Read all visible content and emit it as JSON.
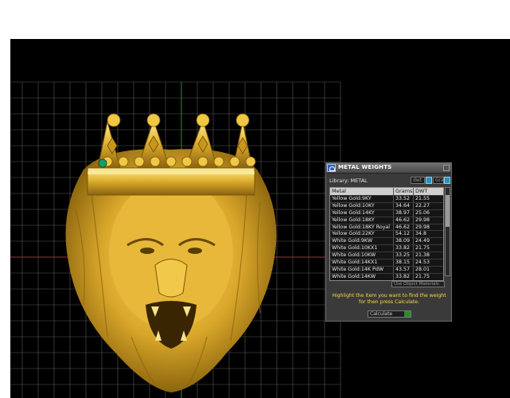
{
  "panel": {
    "title": "METAL WEIGHTS",
    "library_label": "Library: METAL",
    "selectors": [
      "dwt",
      "Gra"
    ],
    "columns": [
      "Metal",
      "Grams",
      "DWT"
    ],
    "rows": [
      {
        "metal": "Yellow Gold:9KY",
        "grams": "33.52",
        "dwt": "21.55"
      },
      {
        "metal": "Yellow Gold:10KY",
        "grams": "34.64",
        "dwt": "22.27"
      },
      {
        "metal": "Yellow Gold:14KY",
        "grams": "38.97",
        "dwt": "25.06"
      },
      {
        "metal": "Yellow Gold:18KY",
        "grams": "46.62",
        "dwt": "29.98"
      },
      {
        "metal": "Yellow Gold:18KY Royal",
        "grams": "46.62",
        "dwt": "29.98"
      },
      {
        "metal": "Yellow Gold:22KY",
        "grams": "54.12",
        "dwt": "34.8"
      },
      {
        "metal": "White Gold:9KW",
        "grams": "38.09",
        "dwt": "24.49"
      },
      {
        "metal": "White Gold:10KX1",
        "grams": "33.82",
        "dwt": "21.75"
      },
      {
        "metal": "White Gold:10KW",
        "grams": "33.25",
        "dwt": "21.38"
      },
      {
        "metal": "White Gold:14KX1",
        "grams": "38.15",
        "dwt": "24.53"
      },
      {
        "metal": "White Gold:14K PdW",
        "grams": "43.57",
        "dwt": "28.01"
      },
      {
        "metal": "White Gold:14KW",
        "grams": "33.82",
        "dwt": "21.75"
      }
    ],
    "option_label": "Use Object Materials",
    "hint": "Highlight the item you want to find the weight for then press Calculate.",
    "calculate_label": "Calculate"
  },
  "icons": {
    "panel": "rhino-app-icon",
    "close": "close-icon",
    "calculate": "play-icon"
  },
  "colors": {
    "viewport_bg": "#000000",
    "gold": "#d4a520",
    "hint_text": "#ffd84a"
  }
}
